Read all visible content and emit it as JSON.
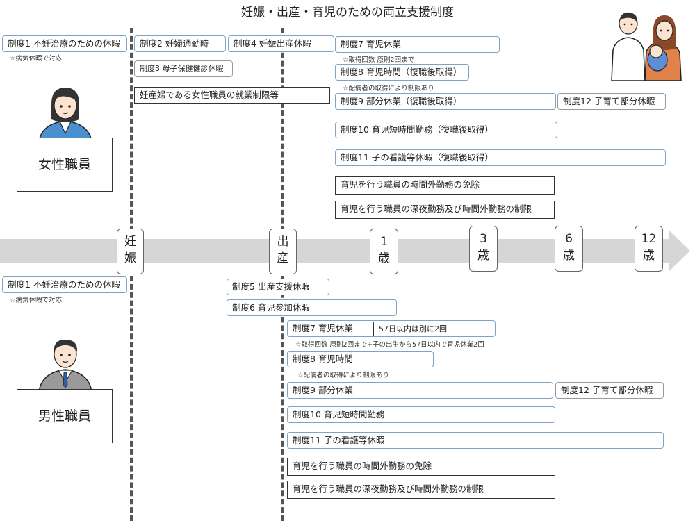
{
  "title": "妊娠・出産・育児のための両立支援制度",
  "stages": {
    "pregnancy": [
      "妊",
      "娠"
    ],
    "birth": [
      "出",
      "産"
    ],
    "age1": [
      "1",
      "歳"
    ],
    "age3": [
      "3",
      "歳"
    ],
    "age6": [
      "6",
      "歳"
    ],
    "age12": [
      "12",
      "歳"
    ]
  },
  "female": {
    "role": "女性職員",
    "s1": "制度1 不妊治療のための休暇",
    "s1_note": "☆病気休暇で対応",
    "s2": "制度2 妊婦通勤時",
    "s4": "制度4 妊娠出産休暇",
    "s3": "制度3 母子保健健診休暇",
    "restrict": "妊産婦である女性職員の就業制限等",
    "s7": "制度7 育児休業",
    "s7_note": "☆取得回数 原則2回まで",
    "s8": "制度8 育児時間（復職後取得）",
    "s8_note": "☆配偶者の取得により制限あり",
    "s9": "制度9 部分休業（復職後取得）",
    "s12": "制度12 子育て部分休暇",
    "s10": "制度10 育児短時間勤務（復職後取得）",
    "s11": "制度11 子の看護等休暇（復職後取得）",
    "ot1": "育児を行う職員の時間外勤務の免除",
    "ot2": "育児を行う職員の深夜勤務及び時間外勤務の制限"
  },
  "male": {
    "role": "男性職員",
    "s1": "制度1 不妊治療のための休暇",
    "s1_note": "☆病気休暇で対応",
    "s5": "制度5 出産支援休暇",
    "s6": "制度6 育児参加休暇",
    "s7": "制度7 育児休業",
    "s7_extra": "57日以内は別に2回",
    "s7_note": "☆取得回数 原則2回まで+子の出生から57日以内で育児休業2回",
    "s8": "制度8 育児時間",
    "s8_note": "☆配偶者の取得により制限あり",
    "s9": "制度9 部分休業",
    "s12": "制度12 子育て部分休暇",
    "s10": "制度10 育児短時間勤務",
    "s11": "制度11 子の看護等休暇",
    "ot1": "育児を行う職員の時間外勤務の免除",
    "ot2": "育児を行う職員の深夜勤務及び時間外勤務の制限"
  },
  "colors": {
    "box_border": "#7fa3c8",
    "arrow": "#d6d6d6",
    "divider": "#555555"
  },
  "icons": [
    "female-worker-icon",
    "male-worker-icon",
    "family-icon"
  ]
}
